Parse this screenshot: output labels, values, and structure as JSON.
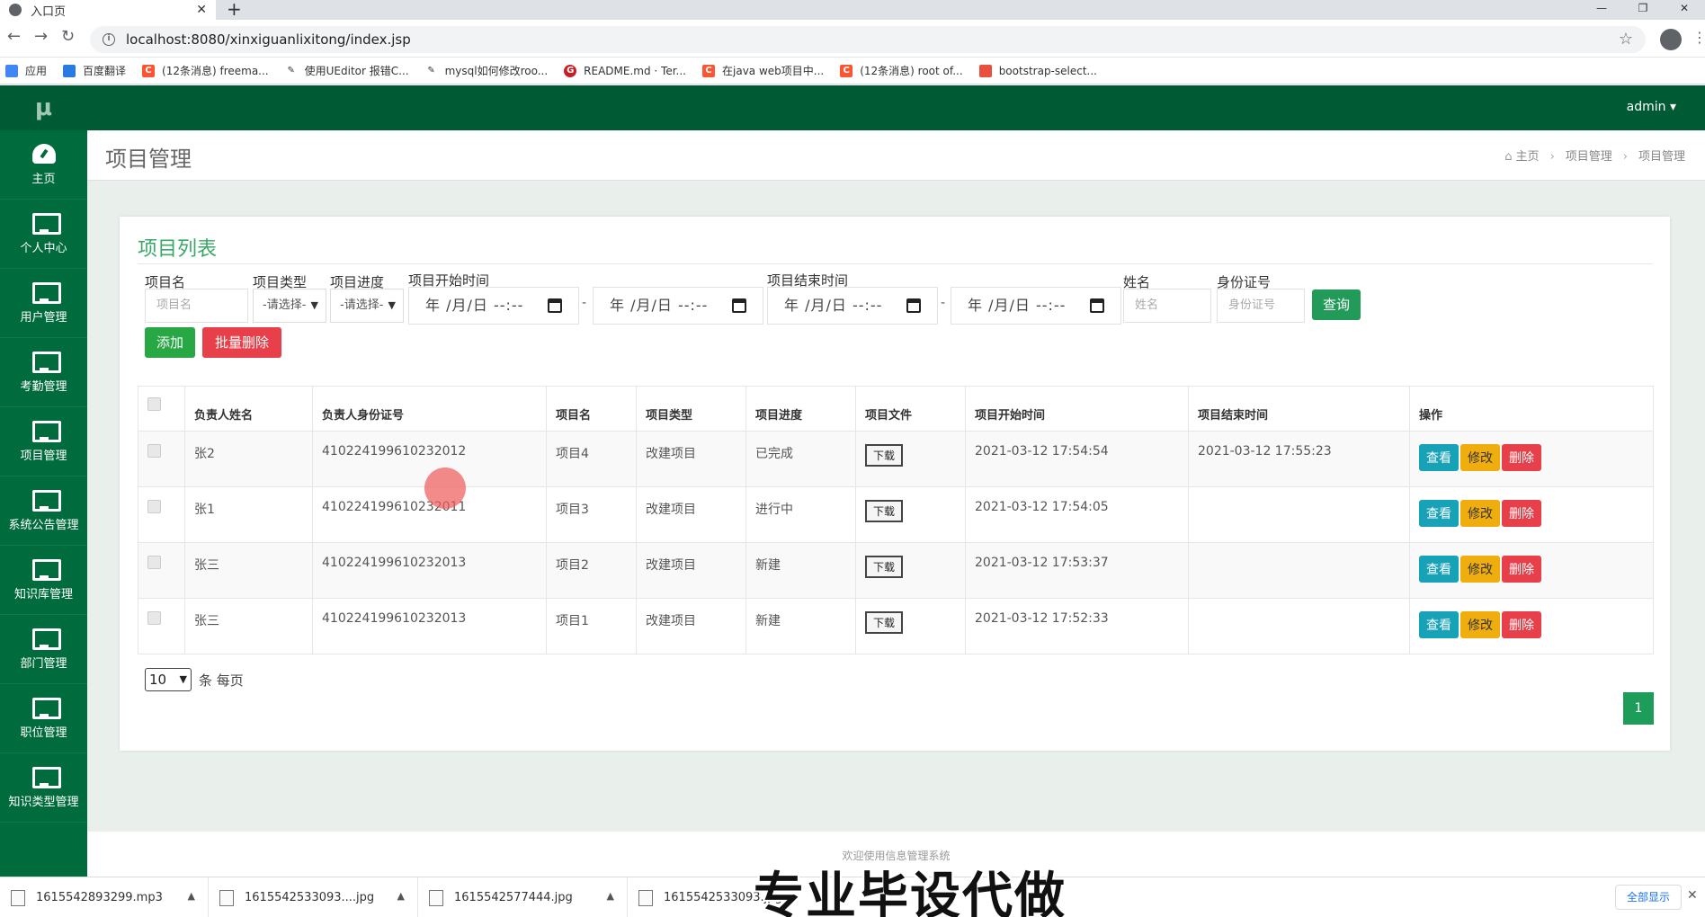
{
  "browser": {
    "tab_title": "入口页",
    "url": "localhost:8080/xinxiguanlixitong/index.jsp",
    "bookmarks": [
      "应用",
      "百度翻译",
      "(12条消息) freema...",
      "使用UEditor 报错C...",
      "mysql如何修改roo...",
      "README.md · Ter...",
      "在java web项目中...",
      "(12条消息) root of...",
      "bootstrap-select..."
    ]
  },
  "app": {
    "logo": "μ",
    "user": "admin ▾",
    "sidebar": [
      "主页",
      "个人中心",
      "用户管理",
      "考勤管理",
      "项目管理",
      "系统公告管理",
      "知识库管理",
      "部门管理",
      "职位管理",
      "知识类型管理"
    ],
    "page_title": "项目管理",
    "breadcrumb": [
      "主页",
      "项目管理",
      "项目管理"
    ]
  },
  "card": {
    "title": "项目列表",
    "filters": {
      "name_label": "项目名",
      "name_placeholder": "项目名",
      "type_label": "项目类型",
      "type_value": "-请选择-",
      "progress_label": "项目进度",
      "progress_value": "-请选择-",
      "start_label": "项目开始时间",
      "end_label": "项目结束时间",
      "date_placeholder": "年 /月/日 --:--",
      "person_label": "姓名",
      "person_placeholder": "姓名",
      "id_label": "身份证号",
      "id_placeholder": "身份证号",
      "dash": "-",
      "search_button": "查询"
    },
    "add_button": "添加",
    "batch_delete_button": "批量删除",
    "table": {
      "headers": [
        "负责人姓名",
        "负责人身份证号",
        "项目名",
        "项目类型",
        "项目进度",
        "项目文件",
        "项目开始时间",
        "项目结束时间",
        "操作"
      ],
      "download": "下载",
      "view": "查看",
      "edit": "修改",
      "delete": "删除",
      "rows": [
        [
          "张2",
          "410224199610232012",
          "项目4",
          "改建项目",
          "已完成",
          "2021-03-12 17:54:54",
          "2021-03-12 17:55:23"
        ],
        [
          "张1",
          "410224199610232011",
          "项目3",
          "改建项目",
          "进行中",
          "2021-03-12 17:54:05",
          ""
        ],
        [
          "张三",
          "410224199610232013",
          "项目2",
          "改建项目",
          "新建",
          "2021-03-12 17:53:37",
          ""
        ],
        [
          "张三",
          "410224199610232013",
          "项目1",
          "改建项目",
          "新建",
          "2021-03-12 17:52:33",
          ""
        ]
      ]
    },
    "page_size": "10",
    "page_size_label": "条 每页",
    "current_page": "1"
  },
  "footer": "欢迎使用信息管理系统",
  "downloads": [
    "1615542893299.mp3",
    "1615542533093....jpg",
    "1615542577444.jpg",
    "1615542533093.jpg"
  ],
  "downloads_show_all": "全部显示",
  "watermark": "专业毕设代做"
}
